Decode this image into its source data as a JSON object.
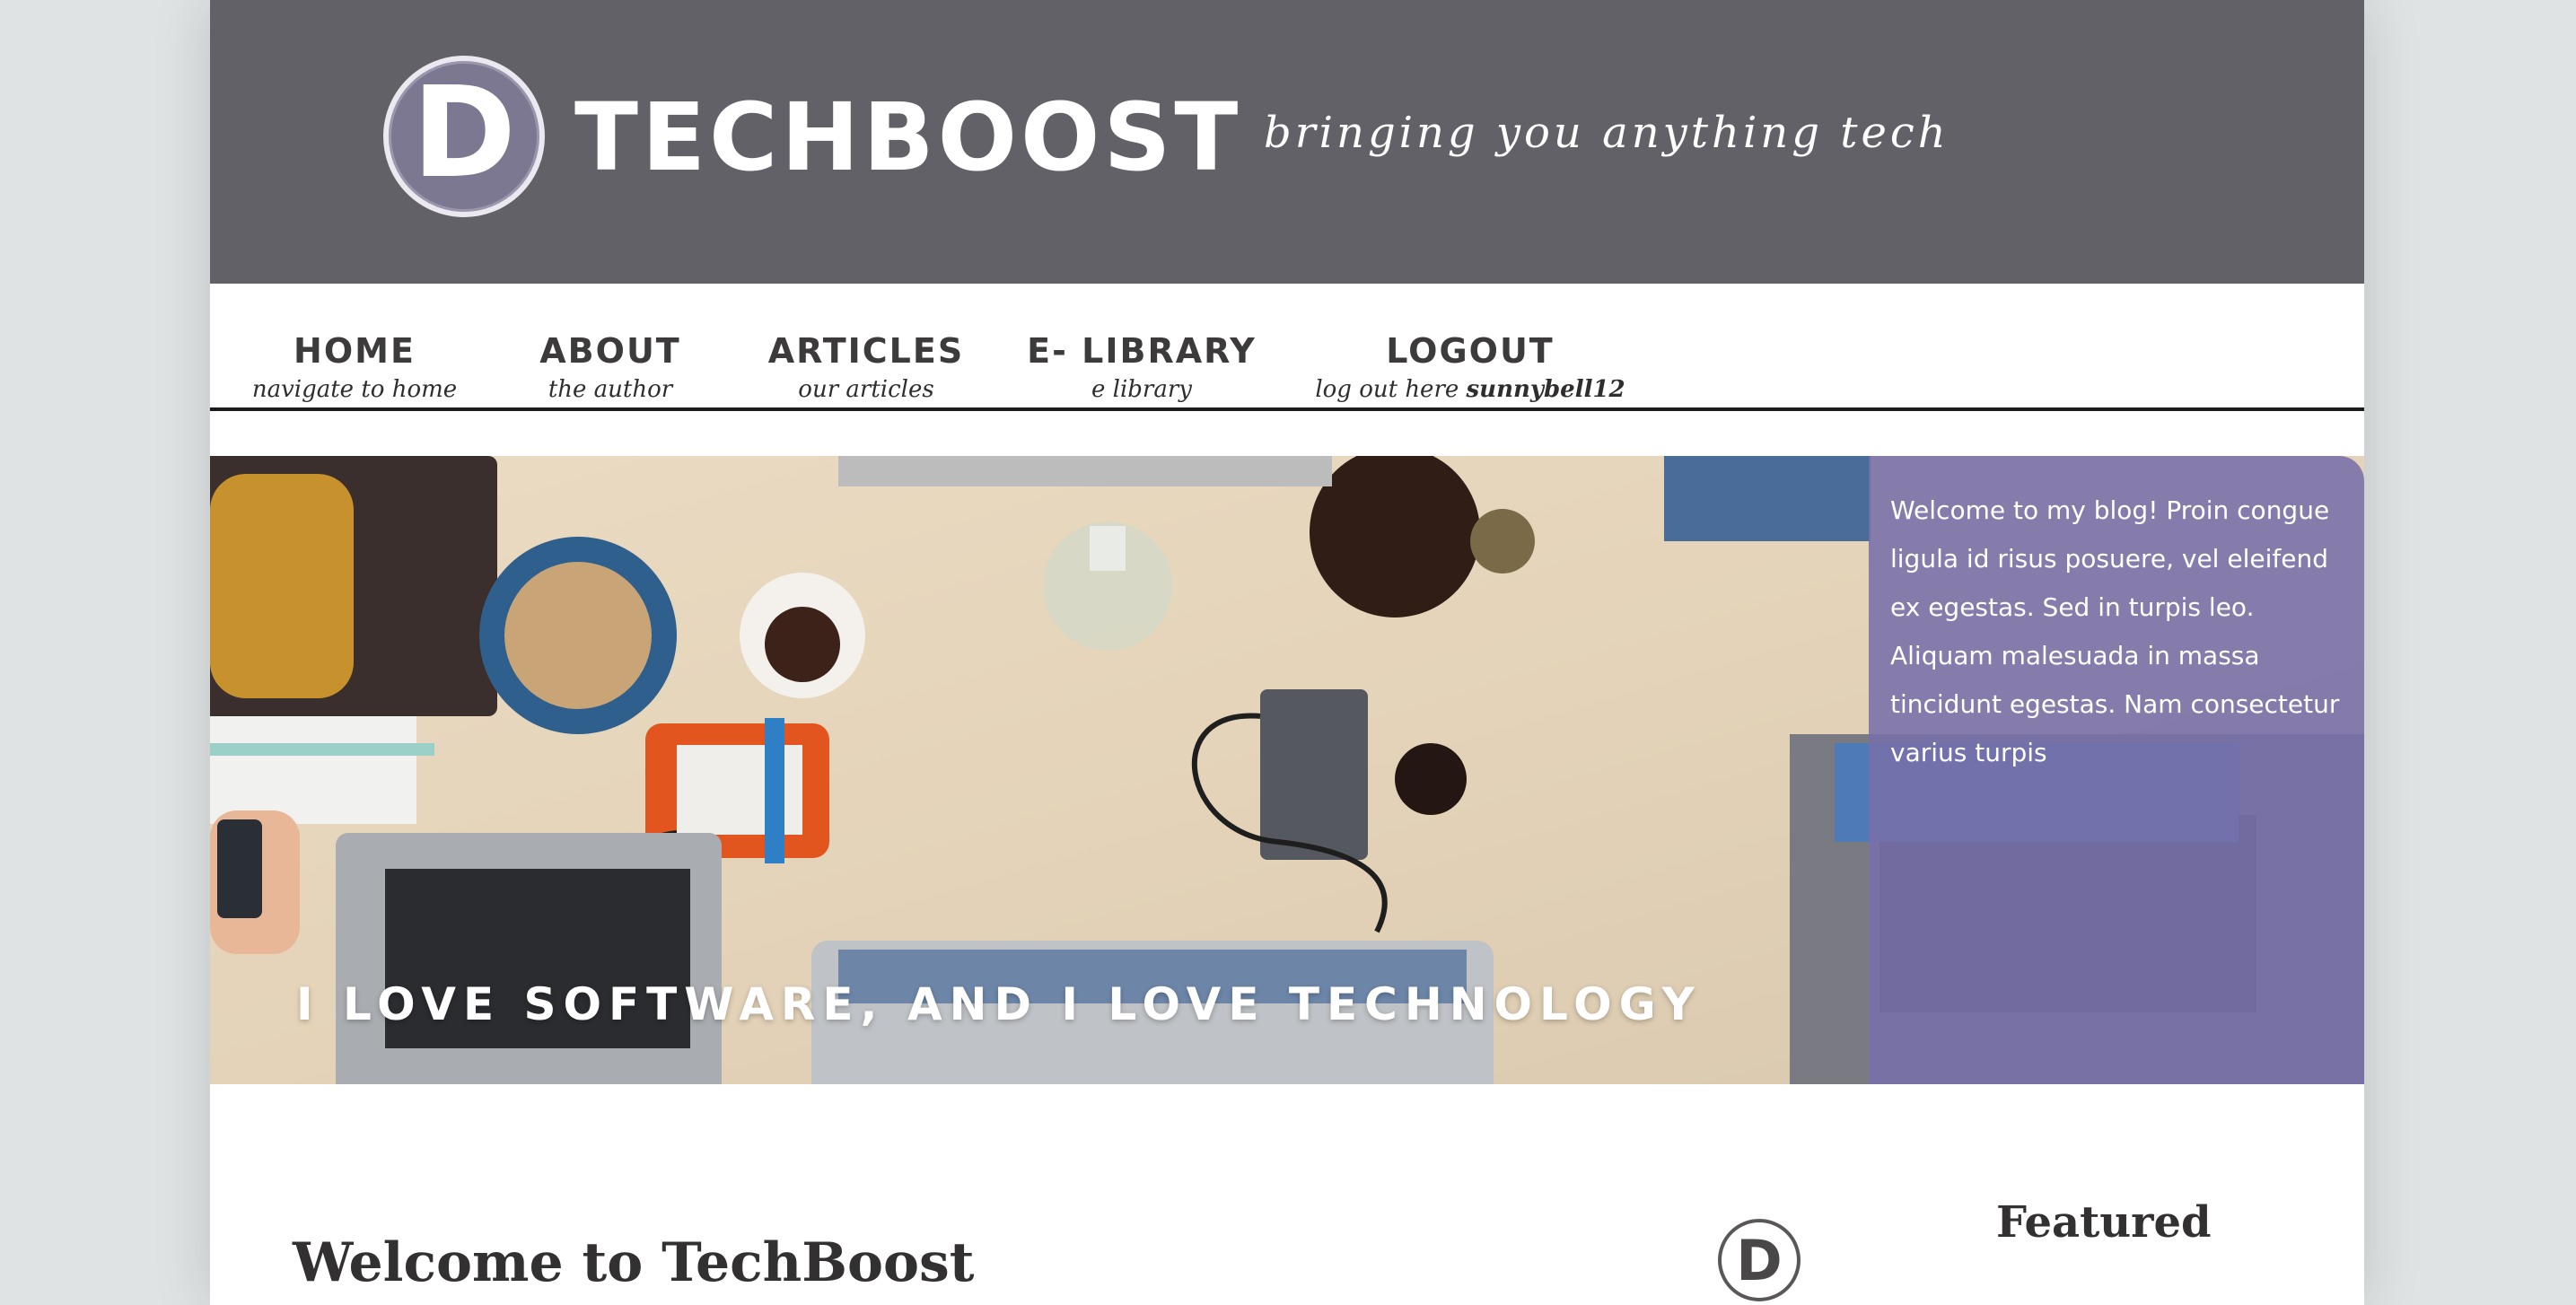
{
  "header": {
    "logo_letter": "D",
    "site_title": "TECHBOOST",
    "tagline": "bringing you anything tech"
  },
  "nav": {
    "items": [
      {
        "label": "HOME",
        "sub": "navigate to home"
      },
      {
        "label": "ABOUT",
        "sub": "the author"
      },
      {
        "label": "ARTICLES",
        "sub": "our articles"
      },
      {
        "label": "E- LIBRARY",
        "sub": "e library"
      },
      {
        "label": "LOGOUT",
        "sub": "log out here ",
        "username": "sunnybell12"
      }
    ]
  },
  "hero": {
    "caption": "I LOVE SOFTWARE, AND I LOVE TECHNOLOGY",
    "welcome_text": "Welcome to my blog! Proin congue ligula id risus posuere, vel eleifend ex egestas. Sed in turpis leo. Aliquam malesuada in massa tincidunt egestas. Nam consectetur varius turpis"
  },
  "content": {
    "title": "Welcome to TechBoost",
    "small_logo_letter": "D",
    "featured_heading": "Featured"
  },
  "colors": {
    "header_bg": "#626168",
    "panel_bg": "#7870aa",
    "page_bg": "#dfe3e4"
  }
}
